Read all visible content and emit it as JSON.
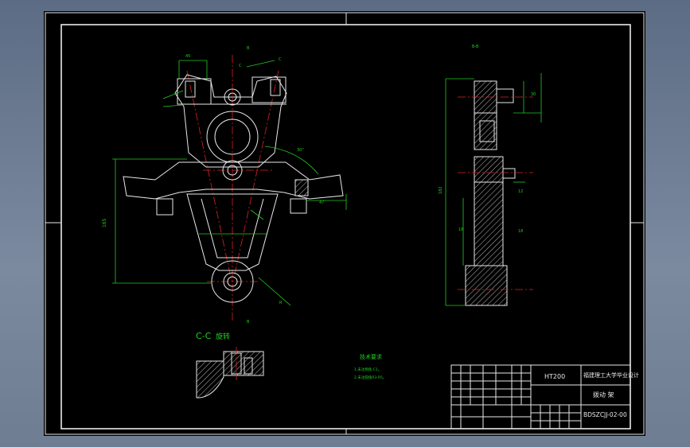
{
  "section_title": "C-C",
  "section_rotate": "旋转",
  "tech_requirements": {
    "heading": "技术要求",
    "items": [
      "1.未注倒角 C1。",
      "2.未注圆角R3-R5。"
    ]
  },
  "title_block": {
    "material": "HT200",
    "school": "福建理工大学毕业设计",
    "part_name": "拨动 架",
    "drawing_no": "BDSZCJJ-02-00"
  },
  "colors": {
    "sheet": "#000000",
    "outline": "#e8e8e8",
    "dimension": "#22cc22",
    "centerline": "#e02020",
    "text_yellow": "#d8c020"
  }
}
